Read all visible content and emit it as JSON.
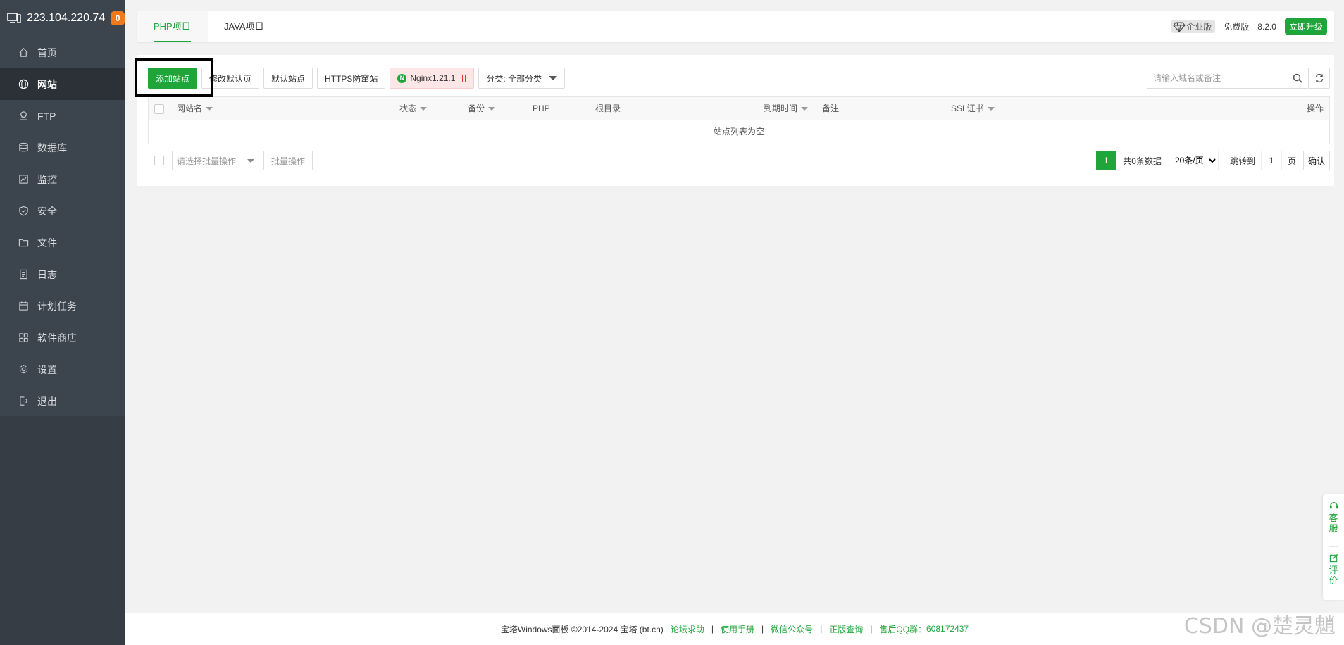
{
  "sidebar": {
    "ip": "223.104.220.74",
    "badge": "0",
    "items": [
      {
        "label": "首页",
        "icon": "home-icon"
      },
      {
        "label": "网站",
        "icon": "globe-icon",
        "active": true
      },
      {
        "label": "FTP",
        "icon": "ftp-icon"
      },
      {
        "label": "数据库",
        "icon": "database-icon"
      },
      {
        "label": "监控",
        "icon": "monitor-icon"
      },
      {
        "label": "安全",
        "icon": "shield-icon"
      },
      {
        "label": "文件",
        "icon": "folder-icon"
      },
      {
        "label": "日志",
        "icon": "log-icon"
      },
      {
        "label": "计划任务",
        "icon": "calendar-icon"
      },
      {
        "label": "软件商店",
        "icon": "grid-icon"
      },
      {
        "label": "设置",
        "icon": "gear-icon"
      },
      {
        "label": "退出",
        "icon": "logout-icon"
      }
    ]
  },
  "topbar": {
    "tabs": [
      "PHP项目",
      "JAVA项目"
    ],
    "enterprise": "企业版",
    "free": "免费版",
    "version": "8.2.0",
    "upgrade": "立即升级"
  },
  "toolbar": {
    "add_site": "添加站点",
    "edit_default": "修改默认页",
    "default_site": "默认站点",
    "https": "HTTPS防窜站",
    "nginx": "Nginx1.21.1",
    "category": "分类: 全部分类",
    "search_placeholder": "请输入域名或备注"
  },
  "table": {
    "columns": {
      "name": "网站名",
      "status": "状态",
      "backup": "备份",
      "php": "PHP",
      "root": "根目录",
      "expire": "到期时间",
      "remark": "备注",
      "ssl": "SSL证书",
      "action": "操作"
    },
    "empty": "站点列表为空"
  },
  "footer_bar": {
    "bulk_placeholder": "请选择批量操作",
    "bulk_button": "批量操作",
    "page": "1",
    "total": "共0条数据",
    "page_size": "20条/页",
    "jump_label": "跳转到",
    "jump_value": "1",
    "page_unit": "页",
    "confirm": "确认"
  },
  "footer": {
    "copyright": "宝塔Windows面板 ©2014-2024 宝塔 (bt.cn)",
    "links": [
      "论坛求助",
      "使用手册",
      "微信公众号",
      "正版查询"
    ],
    "qq_label": "售后QQ群：",
    "qq": "608172437"
  },
  "float": {
    "service": "客服",
    "review": "评价"
  },
  "watermark": "CSDN @楚灵魈",
  "colors": {
    "accent": "#20a53a",
    "sidebar": "#3c444d"
  }
}
